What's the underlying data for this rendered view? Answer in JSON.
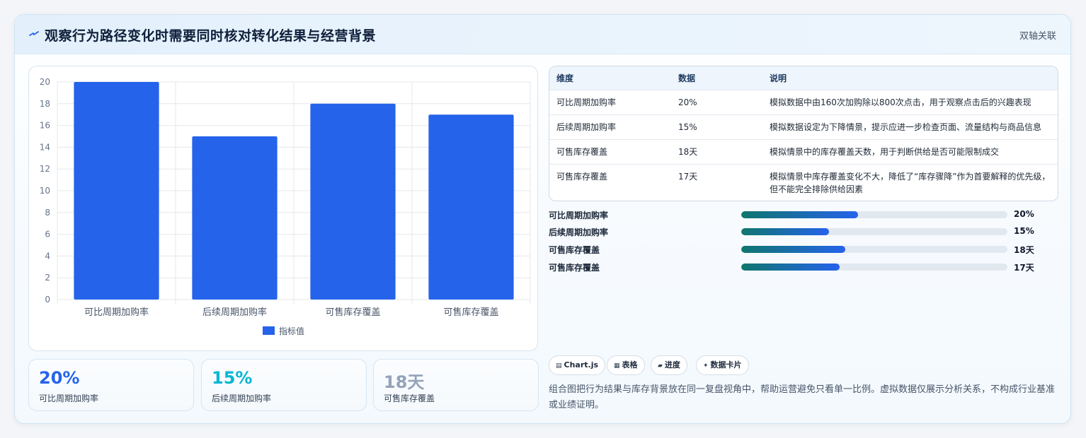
{
  "header": {
    "title": "观察行为路径变化时需要同时核对转化结果与经营背景",
    "tag": "双轴关联",
    "icon": "sparkle-icon"
  },
  "chart_data": {
    "type": "bar",
    "categories": [
      "可比周期加购率",
      "后续周期加购率",
      "可售库存覆盖",
      "可售库存覆盖"
    ],
    "series": [
      {
        "name": "指标值",
        "values": [
          20,
          15,
          18,
          17
        ]
      }
    ],
    "ylim": [
      0,
      20
    ],
    "yticks": [
      0,
      2,
      4,
      6,
      8,
      10,
      12,
      14,
      16,
      18,
      20
    ],
    "grid": true,
    "legend_position": "bottom",
    "color": "#2563eb"
  },
  "kpis": [
    {
      "value": "20%",
      "label": "可比周期加购率",
      "color": "#2563eb"
    },
    {
      "value": "15%",
      "label": "后续周期加购率",
      "color": "#06b6d4"
    },
    {
      "value": "18天",
      "label": "可售库存覆盖",
      "color": "#94a3b8"
    }
  ],
  "table": {
    "headers": [
      "维度",
      "数据",
      "说明"
    ],
    "rows": [
      [
        "可比周期加购率",
        "20%",
        "模拟数据中由160次加购除以800次点击，用于观察点击后的兴趣表现"
      ],
      [
        "后续周期加购率",
        "15%",
        "模拟数据设定为下降情景，提示应进一步检查页面、流量结构与商品信息"
      ],
      [
        "可售库存覆盖",
        "18天",
        "模拟情景中的库存覆盖天数，用于判断供给是否可能限制成交"
      ],
      [
        "可售库存覆盖",
        "17天",
        "模拟情景中库存覆盖变化不大，降低了“库存骤降”作为首要解释的优先级，",
        "但不能完全排除供给因素"
      ]
    ]
  },
  "progress": [
    {
      "label": "可比周期加购率",
      "value": "20%",
      "fraction": 0.44
    },
    {
      "label": "后续周期加购率",
      "value": "15%",
      "fraction": 0.33
    },
    {
      "label": "可售库存覆盖",
      "value": "18天",
      "fraction": 0.39
    },
    {
      "label": "可售库存覆盖",
      "value": "17天",
      "fraction": 0.37
    }
  ],
  "chips": [
    {
      "icon": "▤",
      "label": "Chart.js"
    },
    {
      "icon": "▦",
      "label": "表格"
    },
    {
      "icon": "▰",
      "label": "进度"
    },
    {
      "icon": "✦",
      "label": "数据卡片"
    }
  ],
  "footnote": "组合图把行为结果与库存背景放在同一复盘视角中，帮助运营避免只看单一比例。虚拟数据仅展示分析关系，不构成行业基准或业绩证明。"
}
